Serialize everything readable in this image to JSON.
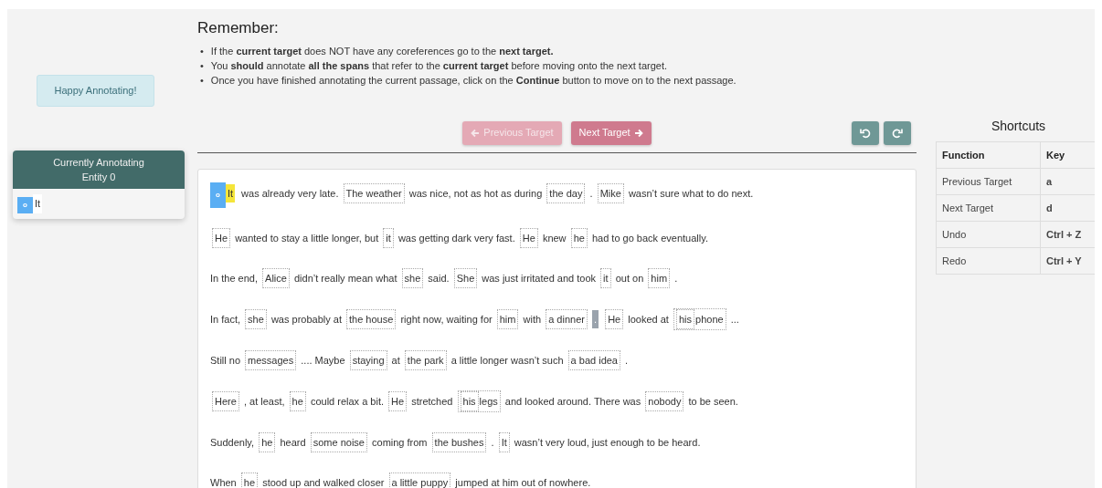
{
  "greeting": "Happy Annotating!",
  "entity_panel": {
    "title": "Currently Annotating",
    "subtitle": "Entity 0",
    "mentions": [
      {
        "badge": "o",
        "text": "It"
      }
    ]
  },
  "instructions": {
    "title": "Remember:",
    "items": [
      {
        "marker": "•",
        "text": "If the **current target** does NOT have any coreferences go to the **next target.**"
      },
      {
        "marker": "•",
        "text": "You **should** annotate **all the spans** that refer to the **current target** before moving onto the next target."
      },
      {
        "marker": "•",
        "text": "Once you have finished annotating the current passage, click on the **Continue** button to move on to the next passage."
      }
    ]
  },
  "nav_buttons": [
    {
      "label": "Previous Target",
      "kind": "previous",
      "disabled": true
    },
    {
      "label": "Next Target",
      "kind": "next",
      "disabled": false
    }
  ],
  "history_buttons": [
    {
      "kind": "undo"
    },
    {
      "kind": "redo"
    }
  ],
  "passage": [
    [
      {
        "kind": "target",
        "badge": "o",
        "text": "It"
      },
      {
        "kind": "text",
        "text": "was already very late."
      },
      {
        "kind": "span",
        "text": "The weather"
      },
      {
        "kind": "text",
        "text": "was nice, not as hot as during"
      },
      {
        "kind": "span",
        "text": "the day"
      },
      {
        "kind": "text",
        "text": "."
      },
      {
        "kind": "span",
        "text": "Mike"
      },
      {
        "kind": "text",
        "text": "wasn’t sure what to do next."
      }
    ],
    [
      {
        "kind": "span",
        "text": "He"
      },
      {
        "kind": "text",
        "text": "wanted to stay a little longer, but"
      },
      {
        "kind": "span",
        "text": "it"
      },
      {
        "kind": "text",
        "text": "was getting dark very fast."
      },
      {
        "kind": "span",
        "text": "He"
      },
      {
        "kind": "text",
        "text": "knew"
      },
      {
        "kind": "span",
        "text": "he"
      },
      {
        "kind": "text",
        "text": "had to go back eventually."
      }
    ],
    [
      {
        "kind": "text",
        "text": "In the end,"
      },
      {
        "kind": "span",
        "text": "Alice"
      },
      {
        "kind": "text",
        "text": "didn’t really mean what"
      },
      {
        "kind": "span",
        "text": "she"
      },
      {
        "kind": "text",
        "text": "said."
      },
      {
        "kind": "span",
        "text": "She"
      },
      {
        "kind": "text",
        "text": "was just irritated and took"
      },
      {
        "kind": "span",
        "text": "it"
      },
      {
        "kind": "text",
        "text": "out on"
      },
      {
        "kind": "span",
        "text": "him"
      },
      {
        "kind": "text",
        "text": "."
      }
    ],
    [
      {
        "kind": "text",
        "text": "In fact,"
      },
      {
        "kind": "span",
        "text": "she"
      },
      {
        "kind": "text",
        "text": "was probably at"
      },
      {
        "kind": "span",
        "text": "the house"
      },
      {
        "kind": "text",
        "text": "right now, waiting for"
      },
      {
        "kind": "span",
        "text": "him"
      },
      {
        "kind": "text",
        "text": "with"
      },
      {
        "kind": "span",
        "text": "a dinner"
      },
      {
        "kind": "cursor",
        "text": "."
      },
      {
        "kind": "span",
        "text": "He"
      },
      {
        "kind": "text",
        "text": "looked at"
      },
      {
        "kind": "span",
        "children": [
          {
            "kind": "span",
            "text": "his"
          },
          {
            "kind": "text",
            "text": "phone"
          }
        ]
      },
      {
        "kind": "text",
        "text": "..."
      }
    ],
    [
      {
        "kind": "text",
        "text": "Still no"
      },
      {
        "kind": "span",
        "text": "messages"
      },
      {
        "kind": "text",
        "text": ".... Maybe"
      },
      {
        "kind": "span",
        "text": "staying"
      },
      {
        "kind": "text",
        "text": "at"
      },
      {
        "kind": "span",
        "text": "the park"
      },
      {
        "kind": "text",
        "text": "a little longer wasn’t such"
      },
      {
        "kind": "span",
        "text": "a bad idea"
      },
      {
        "kind": "text",
        "text": "."
      }
    ],
    [
      {
        "kind": "span",
        "text": "Here"
      },
      {
        "kind": "text",
        "text": ", at least,"
      },
      {
        "kind": "span",
        "text": "he"
      },
      {
        "kind": "text",
        "text": "could relax a bit."
      },
      {
        "kind": "span",
        "text": "He"
      },
      {
        "kind": "text",
        "text": "stretched"
      },
      {
        "kind": "span",
        "children": [
          {
            "kind": "span",
            "text": "his"
          },
          {
            "kind": "text",
            "text": "legs"
          }
        ]
      },
      {
        "kind": "text",
        "text": "and looked around. There was"
      },
      {
        "kind": "span",
        "text": "nobody"
      },
      {
        "kind": "text",
        "text": "to be seen."
      }
    ],
    [
      {
        "kind": "text",
        "text": "Suddenly,"
      },
      {
        "kind": "span",
        "text": "he"
      },
      {
        "kind": "text",
        "text": "heard"
      },
      {
        "kind": "span",
        "text": "some noise"
      },
      {
        "kind": "text",
        "text": "coming from"
      },
      {
        "kind": "span",
        "text": "the bushes"
      },
      {
        "kind": "text",
        "text": "."
      },
      {
        "kind": "span",
        "text": "It"
      },
      {
        "kind": "text",
        "text": "wasn’t very loud, just enough to be heard."
      }
    ],
    [
      {
        "kind": "text",
        "text": "When"
      },
      {
        "kind": "span",
        "text": "he"
      },
      {
        "kind": "text",
        "text": "stood up and walked closer"
      },
      {
        "kind": "span",
        "text": "a little puppy"
      },
      {
        "kind": "text",
        "text": "jumped at him out of nowhere."
      }
    ]
  ],
  "shortcuts": {
    "title": "Shortcuts",
    "columns": [
      "Function",
      "Key"
    ],
    "rows": [
      [
        "Previous Target",
        "a"
      ],
      [
        "Next Target",
        "d"
      ],
      [
        "Undo",
        "Ctrl + Z"
      ],
      [
        "Redo",
        "Ctrl + Y"
      ]
    ]
  }
}
